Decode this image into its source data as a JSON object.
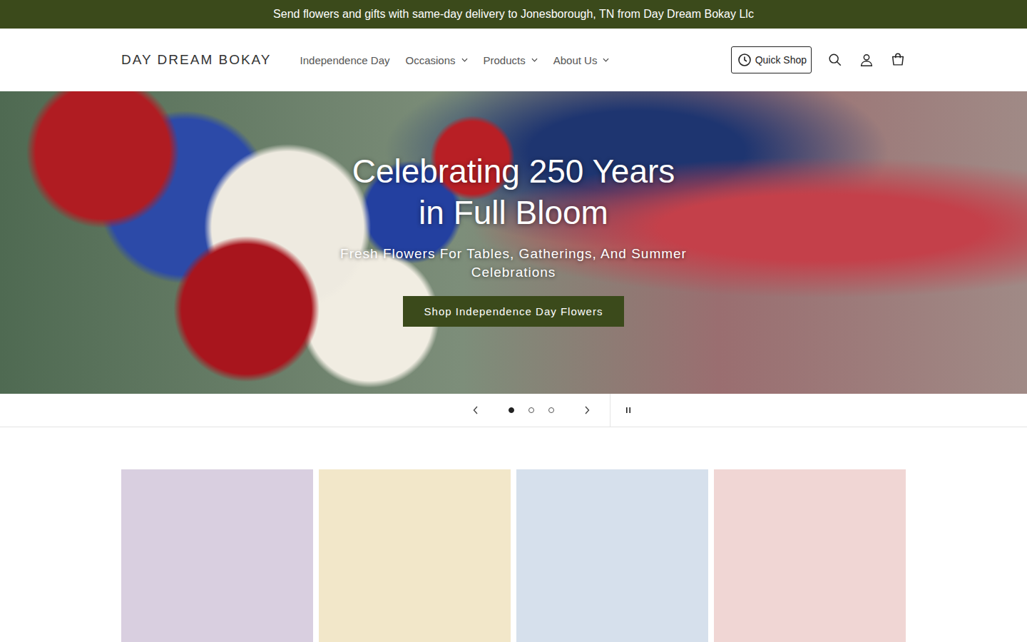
{
  "announcement": "Send flowers and gifts with same-day delivery to Jonesborough, TN from Day Dream Bokay Llc",
  "header": {
    "logo": "DAY DREAM BOKAY",
    "nav": [
      {
        "label": "Independence Day",
        "dropdown": false
      },
      {
        "label": "Occasions",
        "dropdown": true
      },
      {
        "label": "Products",
        "dropdown": true
      },
      {
        "label": "About Us",
        "dropdown": true
      }
    ],
    "quick_shop": "Quick Shop"
  },
  "hero": {
    "title_lines": [
      "Celebrating 250 Years",
      "in Full Bloom"
    ],
    "subtitle": "Fresh Flowers For Tables, Gatherings, And Summer Celebrations",
    "button": "Shop Independence Day Flowers"
  },
  "slider": {
    "slides": [
      {
        "selected": true
      },
      {
        "selected": false
      },
      {
        "selected": false
      }
    ],
    "paused": false
  },
  "products": [
    {
      "color": "#d9cfe0"
    },
    {
      "color": "#f2e7c9"
    },
    {
      "color": "#d6e0ec"
    },
    {
      "color": "#f0d6d4"
    }
  ]
}
